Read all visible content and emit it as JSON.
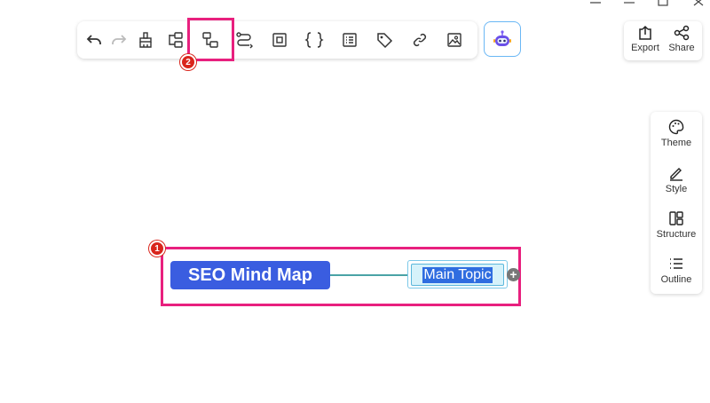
{
  "toolbar": {
    "tools": [
      "undo-icon",
      "redo-icon",
      "format-painter-icon",
      "add-topic-icon",
      "add-subtopic-icon",
      "relationship-icon",
      "boundary-icon",
      "summary-icon",
      "note-icon",
      "tag-icon",
      "link-icon",
      "image-icon"
    ]
  },
  "top_right": {
    "export_label": "Export",
    "share_label": "Share"
  },
  "side_panel": {
    "theme_label": "Theme",
    "style_label": "Style",
    "structure_label": "Structure",
    "outline_label": "Outline"
  },
  "annotations": {
    "badge_1": "1",
    "badge_2": "2"
  },
  "mindmap": {
    "central_topic": "SEO Mind Map",
    "main_topic": "Main Topic",
    "add_symbol": "+"
  },
  "colors": {
    "central_bg": "#3a5de0",
    "connector": "#4aa3a6",
    "highlight": "#e8207e",
    "badge": "#d9251c",
    "ai_border": "#6ab7f5"
  }
}
